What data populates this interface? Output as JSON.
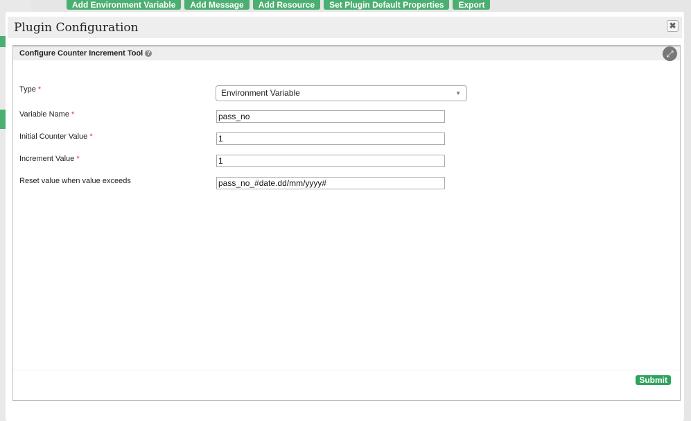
{
  "background": {
    "toolbar": [
      "Add Environment Variable",
      "Add Message",
      "Add Resource",
      "Set Plugin Default Properties",
      "Export"
    ]
  },
  "modal": {
    "title": "Plugin Configuration",
    "close_icon": "close-icon"
  },
  "panel": {
    "title": "Configure Counter Increment Tool",
    "expand_icon": "expand-icon"
  },
  "form": {
    "type": {
      "label": "Type",
      "required": "*",
      "value": "Environment Variable"
    },
    "variable_name": {
      "label": "Variable Name",
      "required": "*",
      "value": "pass_no"
    },
    "initial_counter": {
      "label": "Initial Counter Value",
      "required": "*",
      "value": "1"
    },
    "increment": {
      "label": "Increment Value",
      "required": "*",
      "value": "1"
    },
    "reset": {
      "label": "Reset value when value exceeds",
      "value": "pass_no_#date.dd/mm/yyyy#"
    }
  },
  "submit_label": "Submit"
}
